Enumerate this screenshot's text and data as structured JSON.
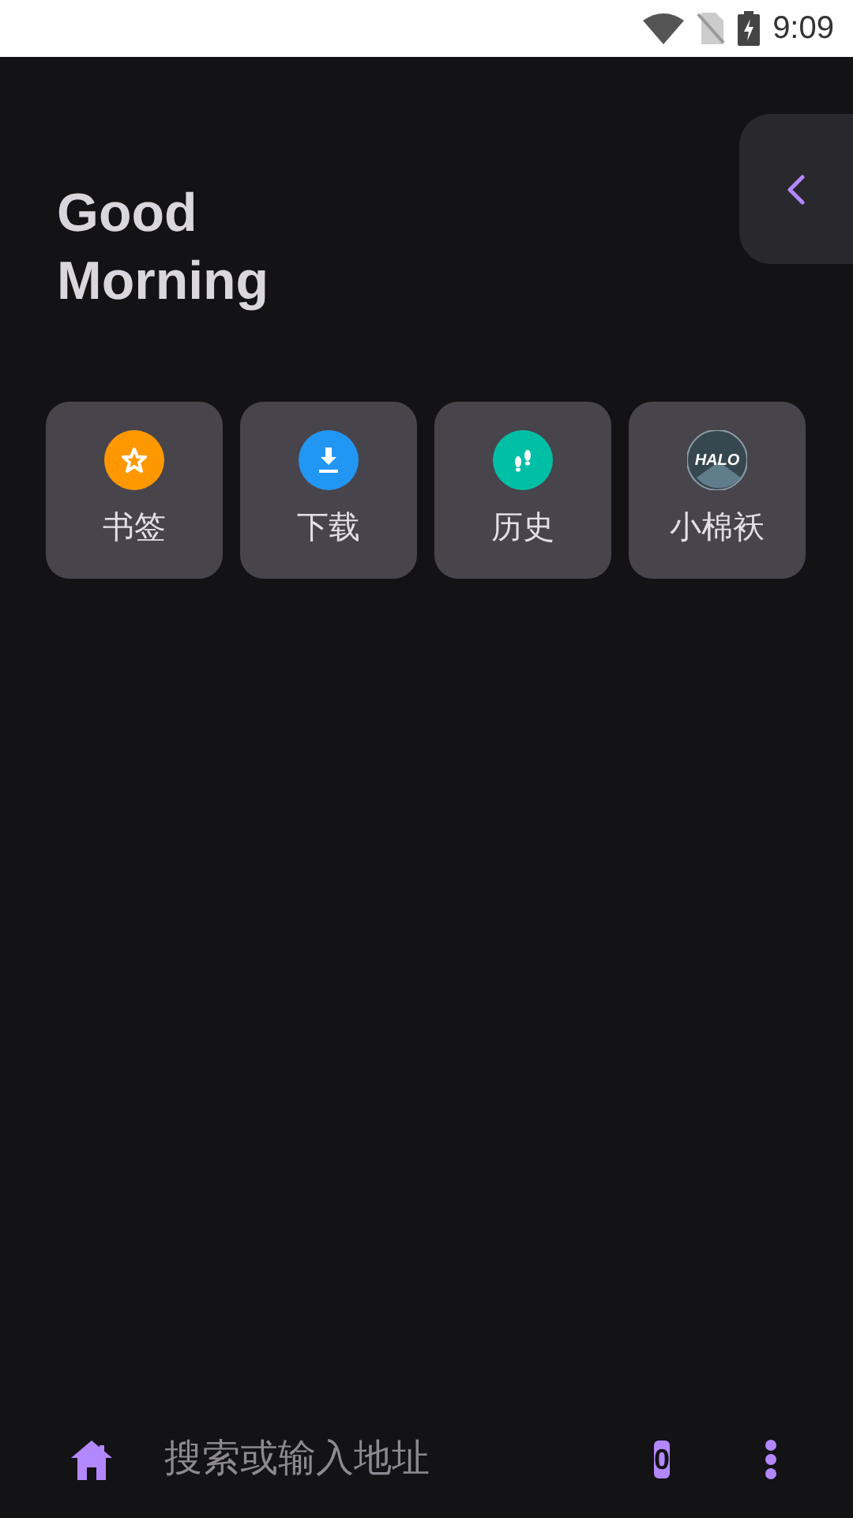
{
  "status_bar": {
    "time": "9:09"
  },
  "greeting": [
    "Good",
    "Morning"
  ],
  "shortcuts": [
    {
      "label": "书签",
      "kind": "star",
      "color": "#ff9800"
    },
    {
      "label": "下载",
      "kind": "download",
      "color": "#2196f3"
    },
    {
      "label": "历史",
      "kind": "footprints",
      "color": "#00bfa5"
    },
    {
      "label": "小棉袄",
      "kind": "logo",
      "color": "#37474f",
      "logo_text": "HALO"
    }
  ],
  "bottom_bar": {
    "placeholder": "搜索或输入地址",
    "tab_count": "0"
  }
}
